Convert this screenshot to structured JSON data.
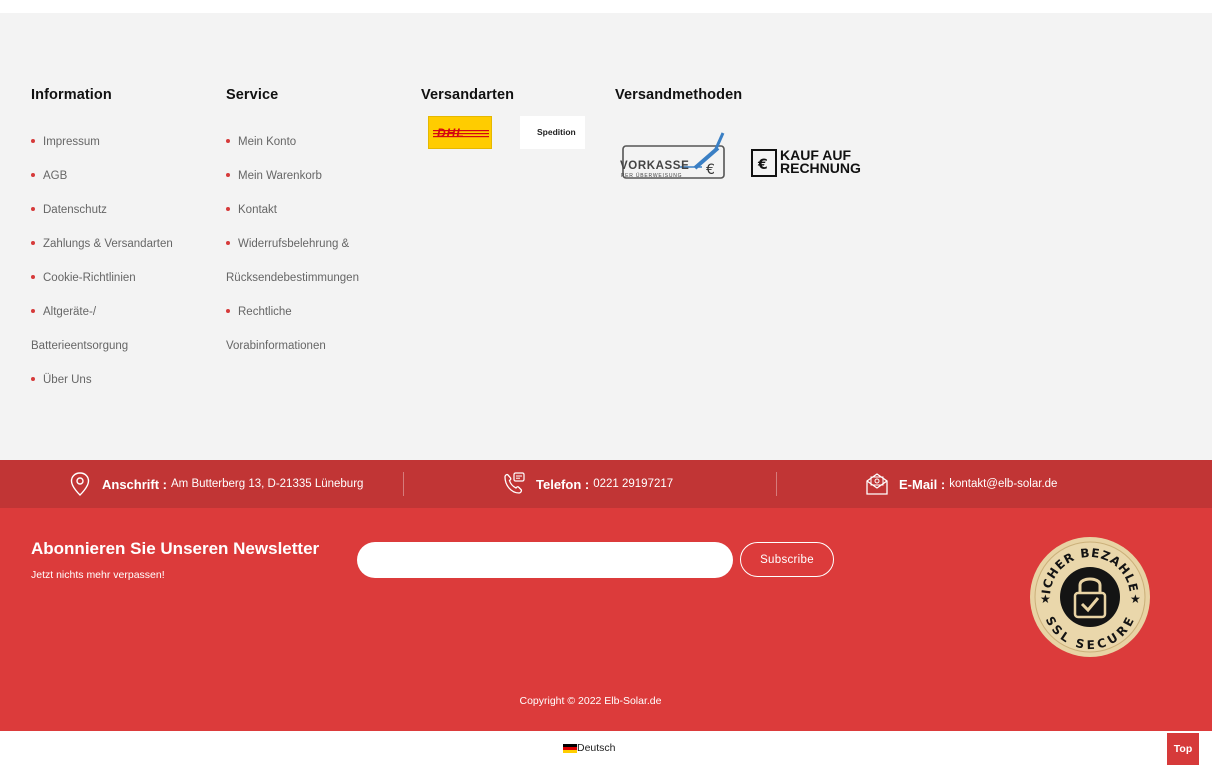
{
  "footer": {
    "information": {
      "title": "Information",
      "items": [
        "Impressum",
        "AGB",
        "Datenschutz",
        "Zahlungs & Versandarten",
        "Cookie-Richtlinien",
        "Altgeräte-/",
        "Batterieentsorgung",
        "Über Uns"
      ]
    },
    "service": {
      "title": "Service",
      "items": [
        "Mein Konto",
        "Mein Warenkorb",
        "Kontakt",
        "Widerrufsbelehrung &",
        "Rücksendebestimmungen",
        "Rechtliche",
        "Vorabinformationen"
      ]
    },
    "versandarten": {
      "title": "Versandarten",
      "logos": {
        "dhl": "DHL",
        "spedition": "Spedition"
      }
    },
    "versandmethoden": {
      "title": "Versandmethoden",
      "vorkasse": {
        "main": "VORKASSE",
        "sub": "PER ÜBERWEISUNG"
      },
      "rechnung": {
        "line1": "KAUF AUF",
        "line2": "RECHNUNG"
      }
    }
  },
  "contact": {
    "address": {
      "label": "Anschrift :",
      "value": "Am Butterberg 13, D-21335 Lüneburg",
      "icon": "location-pin-icon"
    },
    "phone": {
      "label": "Telefon :",
      "value": "0221 29197217",
      "icon": "phone-chat-icon"
    },
    "email": {
      "label": "E-Mail :",
      "value": "kontakt@elb-solar.de",
      "icon": "envelope-icon"
    }
  },
  "newsletter": {
    "title": "Abonnieren Sie Unseren Newsletter",
    "subtitle": "Jetzt nichts mehr verpassen!",
    "input_placeholder": "",
    "button": "Subscribe"
  },
  "ssl_badge": {
    "top": "SICHER BEZAHLEN",
    "bottom": "SSL SECURE"
  },
  "copyright": "Copyright © 2022 Elb-Solar.de",
  "bottom": {
    "language": "Deutsch",
    "top_button": "Top"
  },
  "colors": {
    "accent": "#dc3b3b",
    "contact_bar": "#c13535",
    "footer_bg": "#f3f3f3"
  }
}
